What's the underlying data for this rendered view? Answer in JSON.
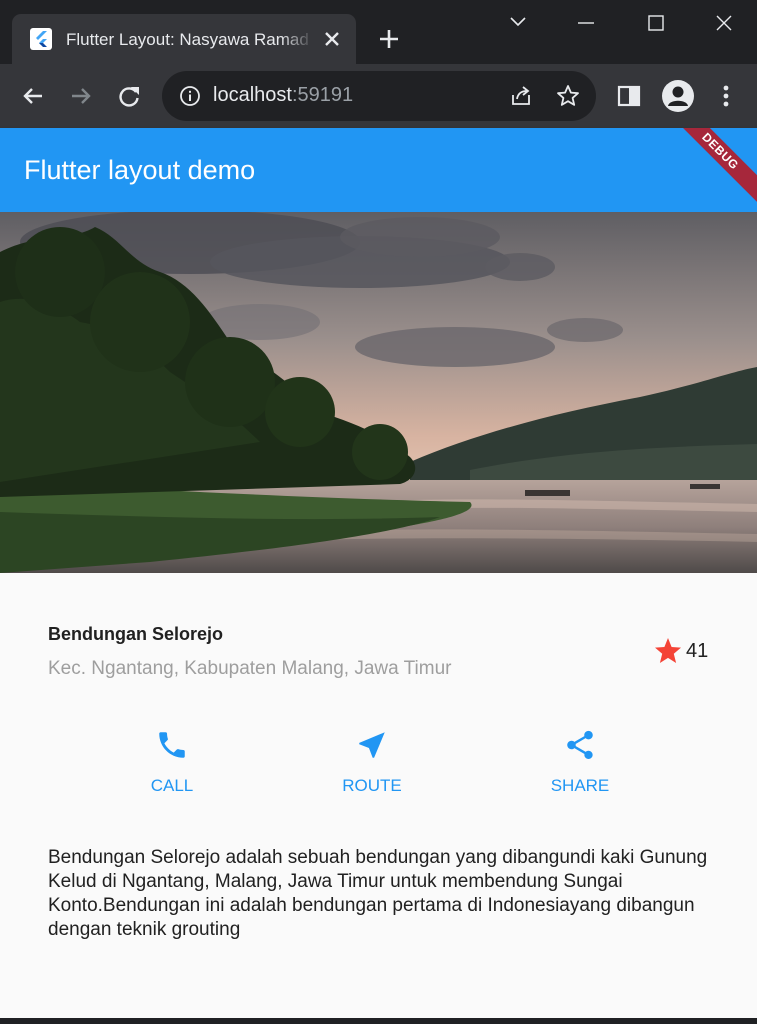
{
  "browser": {
    "tab_title": "Flutter Layout: Nasyawa Ramadhani",
    "url_host": "localhost",
    "url_port": ":59191"
  },
  "app": {
    "title": "Flutter layout demo",
    "debug_banner": "DEBUG"
  },
  "place": {
    "name": "Bendungan Selorejo",
    "location": "Kec. Ngantang, Kabupaten Malang, Jawa Timur",
    "rating_count": "41"
  },
  "actions": [
    {
      "label": "CALL",
      "icon": "phone-icon"
    },
    {
      "label": "ROUTE",
      "icon": "near-me-icon"
    },
    {
      "label": "SHARE",
      "icon": "share-icon"
    }
  ],
  "description": "Bendungan Selorejo adalah sebuah bendungan yang dibangundi kaki Gunung Kelud di Ngantang, Malang, Jawa Timur untuk membendung Sungai Konto.Bendungan ini adalah bendungan pertama di Indonesiayang dibangun dengan teknik grouting",
  "colors": {
    "primary": "#2196f3",
    "star": "#f44336",
    "debug": "#a6273b"
  }
}
